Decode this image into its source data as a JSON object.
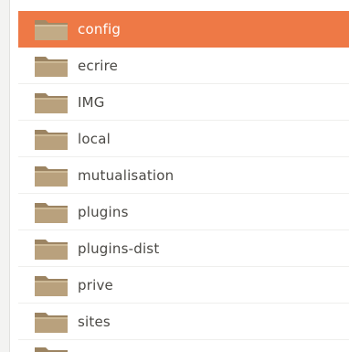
{
  "colors": {
    "selected_bg": "#ee7946",
    "text": "#4b4945",
    "folder_body": "#b9a17d",
    "folder_tab": "#9c8462"
  },
  "icon": "folder-icon",
  "selected_index": 0,
  "items": [
    {
      "name": "config"
    },
    {
      "name": "ecrire"
    },
    {
      "name": "IMG"
    },
    {
      "name": "local"
    },
    {
      "name": "mutualisation"
    },
    {
      "name": "plugins"
    },
    {
      "name": "plugins-dist"
    },
    {
      "name": "prive"
    },
    {
      "name": "sites"
    }
  ]
}
